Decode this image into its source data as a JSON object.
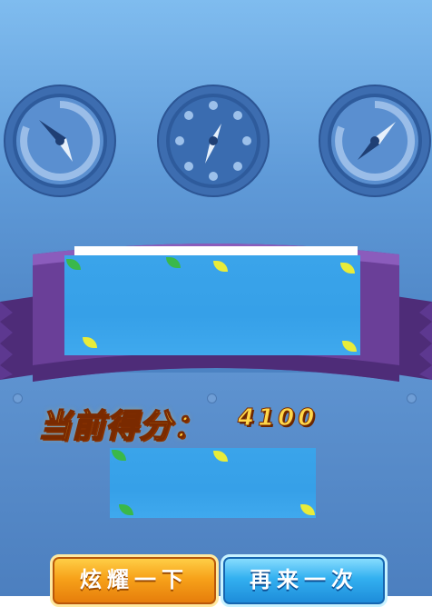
{
  "score": {
    "label": "当前得分：",
    "value": "4100"
  },
  "buttons": {
    "show_off": "炫耀一下",
    "play_again": "再来一次"
  },
  "colors": {
    "background": "#5f9ad8",
    "ribbon": "#6a3f98",
    "panel": "#3aa4ea",
    "score_text": "#ffcf3a",
    "button_orange": "#f7a21a",
    "button_blue": "#33b0f0"
  },
  "icons": [
    "gauge-icon",
    "gauge-icon",
    "gauge-icon",
    "leaf-icon"
  ]
}
